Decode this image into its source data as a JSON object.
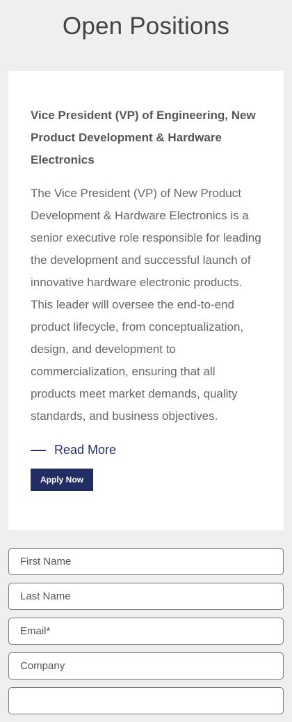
{
  "page": {
    "title": "Open Positions"
  },
  "job": {
    "title": "Vice President (VP) of Engineering, New Product Development & Hardware Electronics",
    "description": "The Vice President (VP) of New Product Development & Hardware Electronics is a senior executive role responsible for leading the development and successful launch of innovative hardware electronic products. This leader will oversee the end-to-end product lifecycle, from conceptualization, design, and development to commercialization, ensuring that all products meet market demands, quality standards, and business objectives.",
    "read_more_label": "Read More",
    "apply_label": "Apply Now"
  },
  "form": {
    "first_name_placeholder": "First Name",
    "last_name_placeholder": "Last Name",
    "email_placeholder": "Email*",
    "company_placeholder": "Company",
    "first_name_value": "",
    "last_name_value": "",
    "email_value": "",
    "company_value": ""
  },
  "colors": {
    "background": "#efefef",
    "card": "#ffffff",
    "accent": "#222e63",
    "link": "#27306a"
  }
}
